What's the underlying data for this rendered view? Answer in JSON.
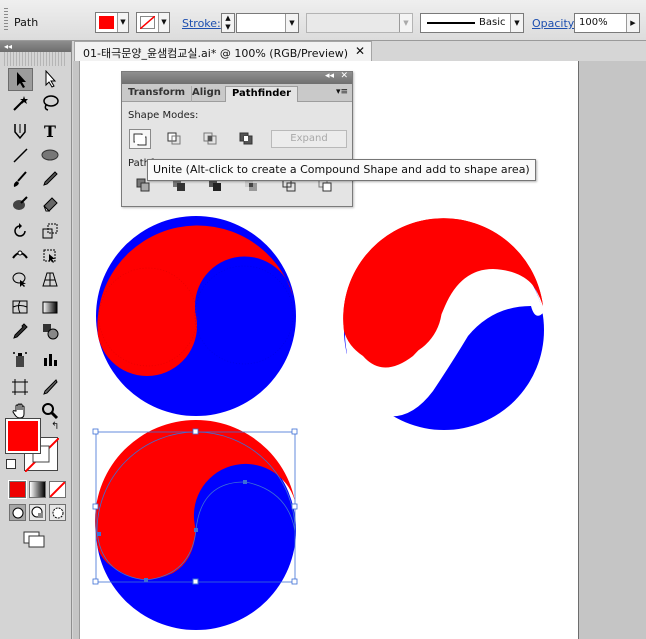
{
  "control_bar": {
    "object_type": "Path",
    "fill_color": "#ff0000",
    "stroke_label": "Stroke:",
    "stroke_weight": "",
    "profile": "",
    "brush_label": "Basic",
    "opacity_label": "Opacity:",
    "opacity_value": "100%"
  },
  "document": {
    "tab_title": "01-태극문양_윤샘컴교실.ai* @ 100% (RGB/Preview)",
    "close_glyph": "✕"
  },
  "tools_panel": {
    "collapse_glyph": "◂◂",
    "fill_color": "#ff0000",
    "swap_glyph": "↰"
  },
  "pathfinder": {
    "tabs": [
      "Transform",
      "Align",
      "Pathfinder"
    ],
    "active_tab": "Pathfinder",
    "shape_modes_label": "Shape Modes:",
    "pathfinders_label": "Pathf",
    "expand_label": "Expand",
    "collapse_glyph": "◂◂",
    "close_glyph": "✕",
    "menu_glyph": "▾≡",
    "tooltip": "Unite (Alt-click to create a Compound Shape and add to shape area)"
  },
  "colors": {
    "red": "#ff0000",
    "blue": "#0000ff",
    "selection": "#3d6fd6",
    "link": "#1d4fb0"
  }
}
